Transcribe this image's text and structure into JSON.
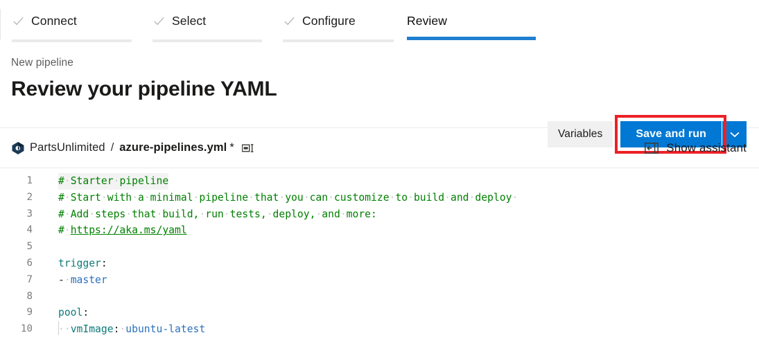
{
  "wizard": {
    "steps": [
      {
        "label": "Connect",
        "state": "complete",
        "icon": "check-icon"
      },
      {
        "label": "Select",
        "state": "complete",
        "icon": "check-icon"
      },
      {
        "label": "Configure",
        "state": "complete",
        "icon": "check-icon"
      },
      {
        "label": "Review",
        "state": "active",
        "icon": ""
      }
    ]
  },
  "header": {
    "breadcrumb": "New pipeline",
    "title": "Review your pipeline YAML",
    "variables_label": "Variables",
    "save_run_label": "Save and run",
    "split_icon": "chevron-down-icon",
    "highlight_color": "#ec2127",
    "accent_color": "#0078d4"
  },
  "filebar": {
    "repo_icon": "azure-repos-icon",
    "repo_name": "PartsUnlimited",
    "separator": "/",
    "file_name": "azure-pipelines.yml",
    "dirty_marker": "*",
    "rename_icon": "rename-icon",
    "assistant_icon": "panel-collapse-icon",
    "assistant_label": "Show assistant"
  },
  "editor": {
    "current_line": 1,
    "lines": [
      {
        "num": "1",
        "tokens": [
          {
            "t": "comment",
            "s": "#"
          },
          {
            "t": "ws",
            "s": "·"
          },
          {
            "t": "comment",
            "s": "Starter"
          },
          {
            "t": "ws",
            "s": "·"
          },
          {
            "t": "comment",
            "s": "pipeline"
          }
        ]
      },
      {
        "num": "2",
        "tokens": [
          {
            "t": "comment",
            "s": "#"
          },
          {
            "t": "ws",
            "s": "·"
          },
          {
            "t": "comment",
            "s": "Start"
          },
          {
            "t": "ws",
            "s": "·"
          },
          {
            "t": "comment",
            "s": "with"
          },
          {
            "t": "ws",
            "s": "·"
          },
          {
            "t": "comment",
            "s": "a"
          },
          {
            "t": "ws",
            "s": "·"
          },
          {
            "t": "comment",
            "s": "minimal"
          },
          {
            "t": "ws",
            "s": "·"
          },
          {
            "t": "comment",
            "s": "pipeline"
          },
          {
            "t": "ws",
            "s": "·"
          },
          {
            "t": "comment",
            "s": "that"
          },
          {
            "t": "ws",
            "s": "·"
          },
          {
            "t": "comment",
            "s": "you"
          },
          {
            "t": "ws",
            "s": "·"
          },
          {
            "t": "comment",
            "s": "can"
          },
          {
            "t": "ws",
            "s": "·"
          },
          {
            "t": "comment",
            "s": "customize"
          },
          {
            "t": "ws",
            "s": "·"
          },
          {
            "t": "comment",
            "s": "to"
          },
          {
            "t": "ws",
            "s": "·"
          },
          {
            "t": "comment",
            "s": "build"
          },
          {
            "t": "ws",
            "s": "·"
          },
          {
            "t": "comment",
            "s": "and"
          },
          {
            "t": "ws",
            "s": "·"
          },
          {
            "t": "comment",
            "s": "deploy"
          },
          {
            "t": "ws",
            "s": "·"
          }
        ]
      },
      {
        "num": "3",
        "tokens": [
          {
            "t": "comment",
            "s": "#"
          },
          {
            "t": "ws",
            "s": "·"
          },
          {
            "t": "comment",
            "s": "Add"
          },
          {
            "t": "ws",
            "s": "·"
          },
          {
            "t": "comment",
            "s": "steps"
          },
          {
            "t": "ws",
            "s": "·"
          },
          {
            "t": "comment",
            "s": "that"
          },
          {
            "t": "ws",
            "s": "·"
          },
          {
            "t": "comment",
            "s": "build,"
          },
          {
            "t": "ws",
            "s": "·"
          },
          {
            "t": "comment",
            "s": "run"
          },
          {
            "t": "ws",
            "s": "·"
          },
          {
            "t": "comment",
            "s": "tests,"
          },
          {
            "t": "ws",
            "s": "·"
          },
          {
            "t": "comment",
            "s": "deploy,"
          },
          {
            "t": "ws",
            "s": "·"
          },
          {
            "t": "comment",
            "s": "and"
          },
          {
            "t": "ws",
            "s": "·"
          },
          {
            "t": "comment",
            "s": "more:"
          }
        ]
      },
      {
        "num": "4",
        "tokens": [
          {
            "t": "comment",
            "s": "#"
          },
          {
            "t": "ws",
            "s": "·"
          },
          {
            "t": "link",
            "s": "https://aka.ms/yaml"
          }
        ]
      },
      {
        "num": "5",
        "tokens": []
      },
      {
        "num": "6",
        "tokens": [
          {
            "t": "key",
            "s": "trigger"
          },
          {
            "t": "punct",
            "s": ":"
          }
        ]
      },
      {
        "num": "7",
        "tokens": [
          {
            "t": "punct",
            "s": "-"
          },
          {
            "t": "ws",
            "s": "·"
          },
          {
            "t": "value",
            "s": "master"
          }
        ]
      },
      {
        "num": "8",
        "tokens": []
      },
      {
        "num": "9",
        "tokens": [
          {
            "t": "key",
            "s": "pool"
          },
          {
            "t": "punct",
            "s": ":"
          }
        ]
      },
      {
        "num": "10",
        "tokens": [
          {
            "t": "guide",
            "s": ""
          },
          {
            "t": "ws",
            "s": "·"
          },
          {
            "t": "ws",
            "s": "·"
          },
          {
            "t": "key",
            "s": "vmImage"
          },
          {
            "t": "punct",
            "s": ":"
          },
          {
            "t": "ws",
            "s": "·"
          },
          {
            "t": "value",
            "s": "ubuntu-latest"
          }
        ]
      }
    ]
  }
}
